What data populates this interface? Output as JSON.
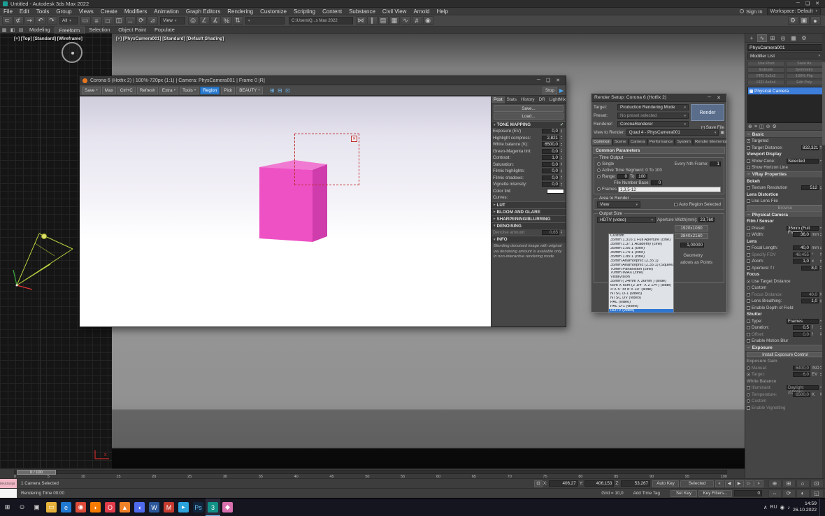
{
  "window": {
    "title": "Untitled - Autodesk 3ds Max 2022"
  },
  "menu": {
    "items": [
      "File",
      "Edit",
      "Tools",
      "Group",
      "Views",
      "Create",
      "Modifiers",
      "Animation",
      "Graph Editors",
      "Rendering",
      "Customize",
      "Scripting",
      "Content",
      "Substance",
      "Civil View",
      "Arnold",
      "Help"
    ],
    "sign_in": "Sign In",
    "workspace": "Workspace: Default"
  },
  "toolbar": {
    "filter_value": "All",
    "refcoord_value": "View",
    "named_sel_value": "",
    "path_text": "C:\\Users\\Q...s Max 2022",
    "icons1": [
      {
        "name": "select-link-icon",
        "glyph": "⊂"
      },
      {
        "name": "unlink-selection-icon",
        "glyph": "⊄"
      },
      {
        "name": "bind-spacewarp-icon",
        "glyph": "⇝"
      },
      {
        "name": "undo-icon",
        "glyph": "↶"
      },
      {
        "name": "redo-icon",
        "glyph": "↷"
      }
    ],
    "icons2": [
      {
        "name": "select-object-icon",
        "glyph": "▭"
      },
      {
        "name": "select-by-name-icon",
        "glyph": "≡"
      },
      {
        "name": "region-select-icon",
        "glyph": "□"
      },
      {
        "name": "window-crossing-icon",
        "glyph": "◫"
      },
      {
        "name": "select-move-icon",
        "glyph": "↔"
      },
      {
        "name": "select-rotate-icon",
        "glyph": "⟳"
      },
      {
        "name": "select-scale-icon",
        "glyph": "⊿"
      }
    ],
    "icons3": [
      {
        "name": "use-pivot-icon",
        "glyph": "◎"
      },
      {
        "name": "snap-toggle-icon",
        "glyph": "∠"
      },
      {
        "name": "angle-snap-icon",
        "glyph": "∡"
      },
      {
        "name": "percent-snap-icon",
        "glyph": "%"
      },
      {
        "name": "spinner-snap-icon",
        "glyph": "⇅"
      }
    ],
    "icons4": [
      {
        "name": "mirror-icon",
        "glyph": "⋈"
      },
      {
        "name": "align-icon",
        "glyph": "∥"
      },
      {
        "name": "layer-manager-icon",
        "glyph": "▤"
      },
      {
        "name": "scene-explorer-icon",
        "glyph": "▦"
      },
      {
        "name": "curve-editor-icon",
        "glyph": "∿"
      },
      {
        "name": "schematic-view-icon",
        "glyph": "#"
      },
      {
        "name": "material-editor-icon",
        "glyph": "◉"
      }
    ],
    "icons_right": [
      {
        "name": "render-setup-icon",
        "glyph": "⚙"
      },
      {
        "name": "rendered-frame-window-icon",
        "glyph": "▣"
      },
      {
        "name": "render-production-icon",
        "glyph": "●"
      }
    ]
  },
  "ribbon": {
    "icons": [
      {
        "name": "ribbon-grid-icon",
        "glyph": "▦"
      },
      {
        "name": "ribbon-box-icon",
        "glyph": "◧"
      },
      {
        "name": "ribbon-poly-icon",
        "glyph": "▤"
      }
    ],
    "tabs": [
      {
        "label": "Modeling"
      },
      {
        "label": "Freeform",
        "active": true
      },
      {
        "label": "Selection"
      },
      {
        "label": "Object Paint"
      },
      {
        "label": "Populate"
      }
    ]
  },
  "viewport": {
    "top_label": "[+] [Top] [Standard] [Wireframe]",
    "camera_label": "[+] [PhysCamera001] [Standard] [Default Shading]"
  },
  "corona": {
    "title": "Corona 6 (Hotfix 2) | 100%-720px (1:1) | Camera: PhysCamera001 | Frame 0 [R]",
    "buttons": [
      {
        "name": "vfb-save-button",
        "label": "Save",
        "type": "dd"
      },
      {
        "name": "vfb-max-button",
        "label": "Max"
      },
      {
        "name": "vfb-copy-button",
        "label": "Ctrl+C"
      },
      {
        "name": "vfb-refresh-button",
        "label": "Refresh"
      },
      {
        "name": "vfb-extra-button",
        "label": "Extra",
        "type": "dd"
      },
      {
        "name": "vfb-tools-button",
        "label": "Tools",
        "type": "dd"
      },
      {
        "name": "vfb-region-button",
        "label": "Region",
        "active": true
      },
      {
        "name": "vfb-pick-button",
        "label": "Pick"
      },
      {
        "name": "vfb-pass-dropdown",
        "label": "BEAUTY",
        "type": "dd"
      }
    ],
    "zoom_icons": [
      {
        "name": "vfb-1to1-icon",
        "glyph": "⊞"
      },
      {
        "name": "vfb-fit-icon",
        "glyph": "⊟"
      },
      {
        "name": "vfb-zoom-icon",
        "glyph": "⊡"
      }
    ],
    "stop_label": "Stop",
    "tabs": [
      {
        "label": "Post",
        "active": true
      },
      {
        "label": "Stats"
      },
      {
        "label": "History"
      },
      {
        "label": "DR"
      },
      {
        "label": "LightMix"
      }
    ],
    "save_btn": "Save...",
    "load_btn": "Load...",
    "sections": {
      "tone": "TONE MAPPING",
      "lut": "LUT",
      "bloom": "BLOOM AND GLARE",
      "sharpen": "SHARPENING/BLURRING",
      "denoise": "DENOISING",
      "info": "INFO"
    },
    "tone_rows": [
      {
        "type": "spin",
        "label": "Exposure (EV)",
        "value": "0,0"
      },
      {
        "type": "spin",
        "label": "Highlight compress:",
        "value": "2,821"
      },
      {
        "type": "spin",
        "label": "White balance (K):",
        "value": "6500,0"
      },
      {
        "type": "spin",
        "label": "Green-Magenta tint:",
        "value": "0,0"
      },
      {
        "type": "spin",
        "label": "Contrast:",
        "value": "1,0"
      },
      {
        "type": "spin",
        "label": "Saturation:",
        "value": "0,0"
      },
      {
        "type": "spin",
        "label": "Filmic highlights:",
        "value": "0,0"
      },
      {
        "type": "spin",
        "label": "Filmic shadows:",
        "value": "0,0"
      },
      {
        "type": "spin",
        "label": "Vignette intensity:",
        "value": "0,0"
      }
    ],
    "color_tint_label": "Color tint:",
    "curves_label": "Curves:",
    "denoise_row": {
      "type": "spin",
      "label": "Denoise amount:",
      "value": "0,65",
      "grayed": true
    },
    "info_text": "Blending denoised image with original via denoising amount is available only in non-interactive rendering mode"
  },
  "render_setup": {
    "title": "Render Setup: Corona 6 (Hotfix 2)",
    "labels": {
      "target": "Target:",
      "preset": "Preset:",
      "renderer": "Renderer:",
      "view": "View to Render:",
      "save_file": "Save File"
    },
    "values": {
      "target": "Production Rendering Mode",
      "preset": "No preset selected",
      "renderer": "CoronaRenderer",
      "view": "Quad 4 - PhysCamera001"
    },
    "render_button": "Render",
    "tabs": [
      {
        "label": "Common",
        "active": true
      },
      {
        "label": "Scene"
      },
      {
        "label": "Camera"
      },
      {
        "label": "Performance"
      },
      {
        "label": "System"
      },
      {
        "label": "Render Elements"
      }
    ],
    "rollout": "Common Parameters",
    "time": {
      "legend": "Time Output",
      "single": "Single",
      "nth_label": "Every Nth Frame:",
      "nth_value": "1",
      "ats_label": "Active Time Segment:",
      "ats_value": "0 To 100",
      "range_label": "Range:",
      "range_from": "0",
      "to_label": "To",
      "range_to": "100",
      "fnb_label": "File Number Base:",
      "fnb_value": "0",
      "frames_label": "Frames",
      "frames_value": "1,3,5-12"
    },
    "area": {
      "legend": "Area to Render",
      "value": "View",
      "auto": "Auto Region Selected"
    },
    "output": {
      "legend": "Output Size",
      "value": "HDTV (video)",
      "aperture_label": "Aperture Width(mm):",
      "aperture_value": "23,760",
      "res1": "1920x1080",
      "res2": "3840x2160",
      "pixel_aspect": "1,00000",
      "partial_1": "Geometry",
      "partial_2": "adows as Points"
    },
    "options": [
      {
        "label": "Custom"
      },
      {
        "label": "35mm 1.316:1 Full Aperture (cine)"
      },
      {
        "label": "35mm 1.37:1 Academy (cine)"
      },
      {
        "label": "35mm 1.66:1 (cine)"
      },
      {
        "label": "35mm 1.75:1 (cine)"
      },
      {
        "label": "35mm 1.85:1 (cine)"
      },
      {
        "label": "35mm Anamorphic (2.35:1)"
      },
      {
        "label": "35mm Anamorphic (2.35:1) (Squeezed)"
      },
      {
        "label": "70mm Panavision (cine)"
      },
      {
        "label": "70mm IMAX (cine)"
      },
      {
        "label": "VistaVision"
      },
      {
        "label": "35mm ( 24mm X 36mm ) (slide)"
      },
      {
        "label": "6cm X 6cm (2 1/4\" X 2 1/4\") (slide)"
      },
      {
        "label": "4\"X 5\" or 8\"X 10\" (slide)"
      },
      {
        "label": "NTSC D-1 (video)"
      },
      {
        "label": "NTSC DV (video)"
      },
      {
        "label": "PAL (video)"
      },
      {
        "label": "PAL D-1 (video)"
      },
      {
        "label": "HDTV (video)",
        "selected": true
      }
    ]
  },
  "panel": {
    "tabs_icons": [
      {
        "name": "create-tab-icon",
        "glyph": "+"
      },
      {
        "name": "modify-tab-icon",
        "glyph": "∿",
        "active": true
      },
      {
        "name": "hierarchy-tab-icon",
        "glyph": "⊞"
      },
      {
        "name": "motion-tab-icon",
        "glyph": "◎"
      },
      {
        "name": "display-tab-icon",
        "glyph": "▦"
      },
      {
        "name": "utilities-tab-icon",
        "glyph": "⚙"
      }
    ],
    "object_name": "PhysCamera001",
    "modifier_list": "Modifier List",
    "modifier_buttons": [
      "Use Pivot",
      "Save As",
      "Extrude",
      "Symmetry",
      "FFD 2x2x2",
      "100% Flip",
      "FFD 4x4x4",
      "Edit Poly"
    ],
    "stack_item": "Physical Camera",
    "stack_icons": [
      {
        "name": "pin-stack-icon",
        "glyph": "⊕"
      },
      {
        "name": "show-end-result-icon",
        "glyph": "≡"
      },
      {
        "name": "make-unique-icon",
        "glyph": "◫"
      },
      {
        "name": "remove-modifier-icon",
        "glyph": "⊘"
      },
      {
        "name": "configure-modifier-sets-icon",
        "glyph": "⚙"
      }
    ],
    "rollout_titles": {
      "basic": "Basic",
      "vray": "VRay Properties",
      "physcam": "Physical Camera",
      "exposure": "Exposure"
    },
    "basic_rows": [
      {
        "type": "check",
        "label": "Targeted",
        "checked": true
      },
      {
        "type": "spin",
        "label": "Target Distance:",
        "value": "832,321"
      },
      {
        "type": "sub",
        "label": "Viewport Display"
      },
      {
        "type": "dd",
        "label": "Show Cone:",
        "value": "Selected"
      },
      {
        "type": "check",
        "label": "Show Horizon Line"
      }
    ],
    "vray_rows": [
      {
        "type": "sub",
        "label": "Bokeh"
      },
      {
        "type": "spin",
        "label": "Texture Resolution",
        "value": "512"
      },
      {
        "type": "sub",
        "label": "Lens Distortion"
      },
      {
        "type": "check",
        "label": "Use Lens File"
      },
      {
        "type": "btn",
        "label": "Browse",
        "grayed": true
      }
    ],
    "physcam_rows": [
      {
        "type": "sub",
        "label": "Film / Sensor"
      },
      {
        "type": "dd",
        "label": "Preset:",
        "value": "35mm (Full Frame)"
      },
      {
        "type": "spin",
        "label": "Width:",
        "value": "36,0",
        "unit": "mm"
      },
      {
        "type": "sub",
        "label": "Lens"
      },
      {
        "type": "spin",
        "label": "Focal Length:",
        "value": "40,0",
        "unit": "mm"
      },
      {
        "type": "check",
        "label": "Specify FOV",
        "value": "48,455",
        "unit": "°",
        "grayed": true
      },
      {
        "type": "spin",
        "label": "Zoom:",
        "value": "1,0",
        "unit": "x"
      },
      {
        "type": "spin",
        "label": "Aperture: f /",
        "value": "8,0"
      },
      {
        "type": "sub",
        "label": "Focus"
      },
      {
        "type": "radio",
        "label": "Use Target Distance",
        "checked": true
      },
      {
        "type": "radio",
        "label": "Custom"
      },
      {
        "type": "spin",
        "label": "Focus Distance:",
        "value": "40,0",
        "grayed": true
      },
      {
        "type": "spin",
        "label": "Lens Breathing:",
        "value": "1,0"
      },
      {
        "type": "check",
        "label": "Enable Depth of Field"
      },
      {
        "type": "sub",
        "label": "Shutter"
      },
      {
        "type": "dd",
        "label": "Type:",
        "value": "Frames"
      },
      {
        "type": "spin",
        "label": "Duration:",
        "value": "0,5",
        "unit": "f"
      },
      {
        "type": "check",
        "label": "Offset:",
        "value": "0,0",
        "unit": "f",
        "grayed": true
      },
      {
        "type": "check",
        "label": "Enable Motion Blur"
      }
    ],
    "exposure_rows": [
      {
        "type": "btn",
        "label": "Install Exposure Control"
      },
      {
        "type": "sub",
        "label": "Exposure Gain",
        "grayed": true
      },
      {
        "type": "radio",
        "label": "Manual:",
        "value": "6400,0",
        "unit": "ISO",
        "grayed": true
      },
      {
        "type": "radio",
        "label": "Target:",
        "value": "6,0",
        "unit": "EV",
        "checked": true,
        "grayed": true
      },
      {
        "type": "sub",
        "label": "White Balance",
        "grayed": true
      },
      {
        "type": "dd",
        "label": "Illuminant:",
        "value": "Daylight (6500K)",
        "grayed": true
      },
      {
        "type": "radio",
        "label": "Temperature:",
        "value": "6500,0",
        "unit": "K",
        "grayed": true
      },
      {
        "type": "radio",
        "label": "Custom",
        "grayed": true
      },
      {
        "type": "check",
        "label": "Enable Vignetting",
        "grayed": true
      }
    ]
  },
  "timeline": {
    "handle": "0 / 100",
    "ticks": [
      "0",
      "5",
      "10",
      "15",
      "20",
      "25",
      "30",
      "35",
      "40",
      "45",
      "50",
      "55",
      "60",
      "65",
      "70",
      "75",
      "80",
      "85",
      "90",
      "95",
      "100"
    ]
  },
  "status": {
    "maxscript": "MAXScript Mi",
    "selected_info": "1 Camera Selected",
    "render_time": "Rendering Time 00:00",
    "x_label": "X:",
    "x_value": "406,27",
    "y_label": "Y:",
    "y_value": "406,153",
    "z_label": "Z:",
    "z_value": "53,267",
    "grid": "Grid = 10,0",
    "add_time_tag": "Add Time Tag",
    "auto_key": "Auto Key",
    "set_key": "Set Key",
    "selected_dd": "Selected",
    "key_filters": "Key Filters...",
    "time_value": "0",
    "transport": [
      {
        "name": "go-to-start-button",
        "glyph": "«"
      },
      {
        "name": "previous-frame-button",
        "glyph": "◀"
      },
      {
        "name": "play-button",
        "glyph": "▶"
      },
      {
        "name": "next-frame-button",
        "glyph": "▷"
      },
      {
        "name": "go-to-end-button",
        "glyph": "»"
      }
    ],
    "nav_icons_row1": [
      {
        "name": "zoom-icon",
        "glyph": "⊕"
      },
      {
        "name": "zoom-all-icon",
        "glyph": "⊞"
      },
      {
        "name": "zoom-extents-icon",
        "glyph": "⌂"
      },
      {
        "name": "zoom-region-icon",
        "glyph": "⊡"
      }
    ],
    "nav_icons_row2": [
      {
        "name": "pan-icon",
        "glyph": "⇔"
      },
      {
        "name": "orbit-icon",
        "glyph": "⟳"
      },
      {
        "name": "fov-icon",
        "glyph": "◐"
      },
      {
        "name": "maximize-viewport-icon",
        "glyph": "◱"
      }
    ]
  },
  "taskbar": {
    "lang": "RU",
    "time": "14:59",
    "date": "26.10.2022",
    "icons": [
      {
        "name": "taskbar-start-icon",
        "glyph": "⊞",
        "fg": "#e8e8e8"
      },
      {
        "name": "taskbar-search-icon",
        "glyph": "⊙",
        "fg": "#cfcfcf"
      },
      {
        "name": "taskbar-task-view-icon",
        "glyph": "▣",
        "fg": "#cfcfcf"
      },
      {
        "name": "taskbar-explorer-icon",
        "glyph": "▭",
        "bg": "#e8b33c",
        "fg": "#fff8e0"
      },
      {
        "name": "taskbar-edge-icon",
        "glyph": "e",
        "bg": "#1f78d1",
        "fg": "#eaf6ff"
      },
      {
        "name": "taskbar-chrome-icon",
        "glyph": "◉",
        "bg": "#dd4b39",
        "fg": "#fff"
      },
      {
        "name": "taskbar-firefox-icon",
        "glyph": "◗",
        "bg": "#f57c00",
        "fg": "#fff"
      },
      {
        "name": "taskbar-opera-icon",
        "glyph": "O",
        "bg": "#e23b4a",
        "fg": "#fff"
      },
      {
        "name": "taskbar-media-icon",
        "glyph": "▲",
        "bg": "#ef8228",
        "fg": "#fff"
      },
      {
        "name": "taskbar-chat-icon",
        "glyph": "◖",
        "bg": "#4f6bed",
        "fg": "#fff"
      },
      {
        "name": "taskbar-word-icon",
        "glyph": "W",
        "bg": "#2b579a",
        "fg": "#fff"
      },
      {
        "name": "taskbar-mail-icon",
        "glyph": "M",
        "bg": "#c63b2f",
        "fg": "#fff"
      },
      {
        "name": "taskbar-telegram-icon",
        "glyph": "▸",
        "bg": "#2ba3dd",
        "fg": "#fff"
      },
      {
        "name": "taskbar-photoshop-icon",
        "glyph": "Ps",
        "bg": "#10263c",
        "fg": "#6fc0f5"
      },
      {
        "name": "taskbar-3dsmax-icon",
        "glyph": "3",
        "bg": "#128f86",
        "fg": "#eafffb",
        "active": true
      },
      {
        "name": "taskbar-pink-app-icon",
        "glyph": "◆",
        "bg": "#d86fae",
        "fg": "#fff"
      }
    ]
  }
}
